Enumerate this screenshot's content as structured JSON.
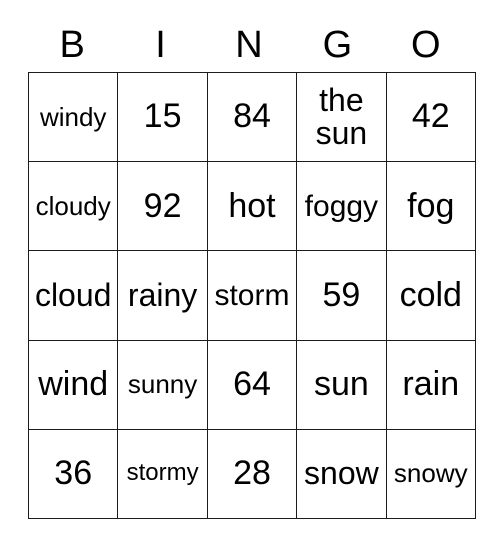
{
  "card": {
    "title": "BINGO",
    "headers": [
      "B",
      "I",
      "N",
      "G",
      "O"
    ],
    "rows": [
      [
        {
          "text": "windy",
          "size": "fs-sm"
        },
        {
          "text": "15",
          "size": "fs-xl"
        },
        {
          "text": "84",
          "size": "fs-xl"
        },
        {
          "text": "the sun",
          "size": "fs-lg"
        },
        {
          "text": "42",
          "size": "fs-xl"
        }
      ],
      [
        {
          "text": "cloudy",
          "size": "fs-sm"
        },
        {
          "text": "92",
          "size": "fs-xl"
        },
        {
          "text": "hot",
          "size": "fs-xl"
        },
        {
          "text": "foggy",
          "size": "fs-md"
        },
        {
          "text": "fog",
          "size": "fs-xl"
        }
      ],
      [
        {
          "text": "cloud",
          "size": "fs-lg"
        },
        {
          "text": "rainy",
          "size": "fs-lg"
        },
        {
          "text": "storm",
          "size": "fs-md"
        },
        {
          "text": "59",
          "size": "fs-xl"
        },
        {
          "text": "cold",
          "size": "fs-xl"
        }
      ],
      [
        {
          "text": "wind",
          "size": "fs-xl"
        },
        {
          "text": "sunny",
          "size": "fs-sm"
        },
        {
          "text": "64",
          "size": "fs-xl"
        },
        {
          "text": "sun",
          "size": "fs-xl"
        },
        {
          "text": "rain",
          "size": "fs-xl"
        }
      ],
      [
        {
          "text": "36",
          "size": "fs-xl"
        },
        {
          "text": "stormy",
          "size": "fs-xs"
        },
        {
          "text": "28",
          "size": "fs-xl"
        },
        {
          "text": "snow",
          "size": "fs-lg"
        },
        {
          "text": "snowy",
          "size": "fs-sm"
        }
      ]
    ]
  },
  "colors": {
    "background": "#ffffff",
    "text": "#000000",
    "border": "#1c1c1c"
  }
}
